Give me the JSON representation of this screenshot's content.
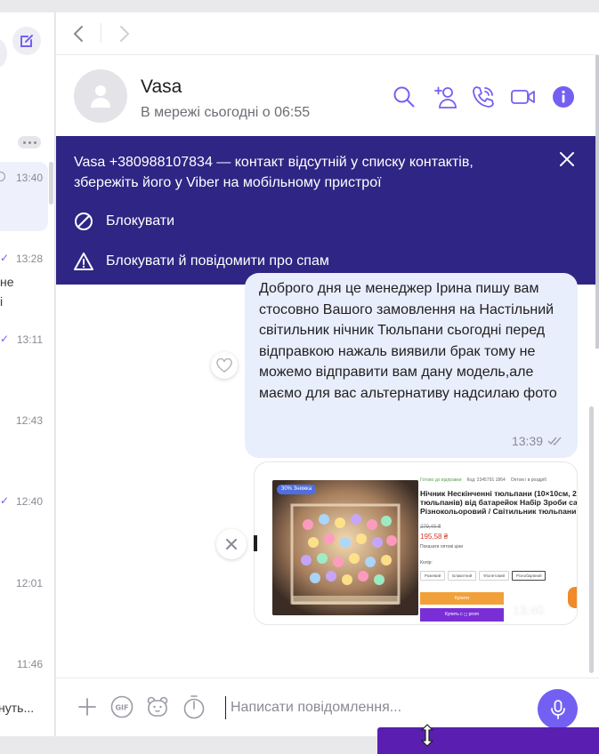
{
  "sidebar": {
    "more_label": "•••",
    "rows": [
      {
        "time": "13:40",
        "status": "pending"
      },
      {
        "time": "13:28",
        "status": "read"
      },
      {
        "time": "13:11",
        "status": "read"
      },
      {
        "time": "12:43",
        "status": "none"
      },
      {
        "time": "12:40",
        "status": "read"
      },
      {
        "time": "12:01",
        "status": "none"
      },
      {
        "time": "11:46",
        "status": "none"
      }
    ],
    "snippet_1": "не",
    "snippet_2": "і",
    "draft_snippet": "нуть..."
  },
  "contact": {
    "name": "Vasa",
    "status": "В мережі сьогодні о 06:55"
  },
  "banner": {
    "text": "Vasa +380988107834 — контакт відсутній у списку контактів, збережіть його у Viber на мобільному пристрої",
    "block_label": "Блокувати",
    "block_report_label": "Блокувати й повідомити про спам"
  },
  "messages": [
    {
      "text": "Доброго дня це менеджер Ірина пишу вам стосовно Вашого замовлення на Настільний світильник нічник Тюльпани сьогодні перед відправкою нажаль виявили брак тому не можемо відправити вам дану модель,але маємо для вас альтернативу надсилаю фото",
      "time": "13:39"
    },
    {
      "type": "image",
      "time": "13:40",
      "product": {
        "photo_badge": "30% Знижка",
        "availability": "Готово до відправки",
        "code": "Код: 2345791 1864",
        "wholesale": "Оптом і в роздріб",
        "title_line1": "Нічник Нескінченні тюльпани (10×10см, 2",
        "title_line2": "тюльпанів) від батарейок Набір Зроби сам",
        "title_line3": "Різнокольоровий / Світильник тюльпани",
        "old_price": "279,40 ₴",
        "price": "195,58 ₴",
        "opt_note": "Показати оптові ціни",
        "color_label": "Колір:",
        "colors": [
          "Рожевий",
          "Блакитний",
          "Фіолетовий",
          "Різнобарвний"
        ],
        "buy_label": "Купити",
        "prom_label": "Купить с ◻ prom"
      }
    }
  ],
  "input": {
    "placeholder": "Написати повідомлення..."
  },
  "colors": {
    "accent": "#7360f2",
    "banner": "#2f2584",
    "bubble": "#e9eefc"
  }
}
